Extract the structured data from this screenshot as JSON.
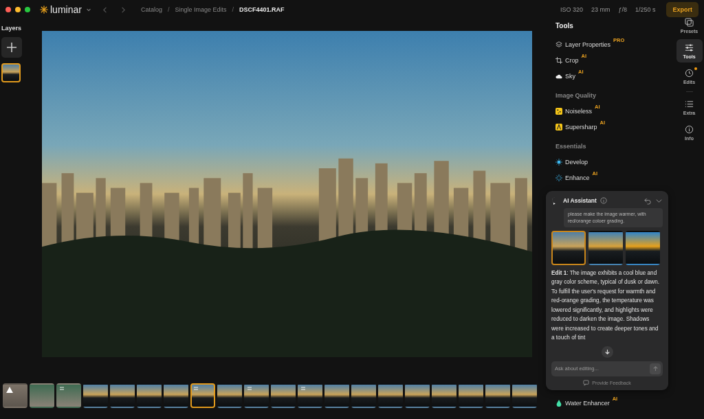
{
  "window": {
    "app_name": "luminar"
  },
  "breadcrumb": [
    {
      "label": "Catalog",
      "current": false
    },
    {
      "separator": "/",
      "label": "Single Image Edits",
      "current": false
    },
    {
      "separator": "/",
      "label": "DSCF4401.RAF",
      "current": true
    }
  ],
  "exif": [
    "ISO 320",
    "23 mm",
    "ƒ/8",
    "1/250 s"
  ],
  "export_button": "Export",
  "layers": {
    "title": "Layers",
    "items": [
      {
        "selected": true
      }
    ]
  },
  "tools": {
    "title": "Tools",
    "sections": [
      {
        "items": [
          {
            "label": "Layer Properties",
            "badge": "PRO"
          },
          {
            "label": "Crop",
            "badge": "AI"
          },
          {
            "label": "Sky",
            "badge": "AI"
          }
        ]
      },
      {
        "heading": "Image Quality",
        "items": [
          {
            "label": "Noiseless",
            "badge": "AI"
          },
          {
            "label": "Supersharp",
            "badge": "AI"
          }
        ]
      },
      {
        "heading": "Essentials",
        "items": [
          {
            "label": "Develop"
          },
          {
            "label": "Enhance",
            "badge": "AI"
          }
        ]
      }
    ],
    "bottom_item": {
      "label": "Water Enhancer",
      "badge": "AI"
    }
  },
  "rail": [
    {
      "label": "Presets",
      "selected": false,
      "notification": false
    },
    {
      "label": "Tools",
      "selected": true,
      "notification": false
    },
    {
      "label": "Edits",
      "selected": false,
      "notification": true
    },
    {
      "label": "Extra",
      "selected": false,
      "notification": false
    },
    {
      "label": "Info",
      "selected": false,
      "notification": false
    }
  ],
  "assistant": {
    "title": "AI Assistant",
    "prompt": "please make the image warmer, with red/orange coloer grading.",
    "variants": [
      {
        "selected": true
      },
      {
        "selected": false
      },
      {
        "selected": false
      }
    ],
    "response": "**Edit 1**: The image exhibits a cool blue and gray color scheme, typical of dusk or dawn. To fulfill the user's request for warmth and red-orange grading, the temperature was lowered significantly, and highlights were reduced to darken the image. Shadows were increased to create deeper tones and a touch of tint",
    "input_placeholder": "Ask about editing...",
    "feedback": "Provide Feedback"
  },
  "filmstrip": [
    {
      "kind": "object",
      "warning": true,
      "edited": false,
      "selected": false
    },
    {
      "kind": "portrait",
      "warning": false,
      "edited": false,
      "selected": false
    },
    {
      "kind": "portrait",
      "warning": false,
      "edited": true,
      "selected": false
    },
    {
      "kind": "city",
      "warning": false,
      "edited": false,
      "selected": false
    },
    {
      "kind": "city",
      "warning": false,
      "edited": false,
      "selected": false
    },
    {
      "kind": "city",
      "warning": false,
      "edited": false,
      "selected": false
    },
    {
      "kind": "city",
      "warning": false,
      "edited": false,
      "selected": false
    },
    {
      "kind": "city",
      "warning": false,
      "edited": true,
      "selected": true
    },
    {
      "kind": "city",
      "warning": false,
      "edited": false,
      "selected": false
    },
    {
      "kind": "city",
      "warning": false,
      "edited": true,
      "selected": false
    },
    {
      "kind": "city",
      "warning": false,
      "edited": false,
      "selected": false
    },
    {
      "kind": "city",
      "warning": false,
      "edited": true,
      "selected": false
    },
    {
      "kind": "city",
      "warning": false,
      "edited": false,
      "selected": false
    },
    {
      "kind": "city",
      "warning": false,
      "edited": false,
      "selected": false
    },
    {
      "kind": "city",
      "warning": false,
      "edited": false,
      "selected": false
    },
    {
      "kind": "city",
      "warning": false,
      "edited": false,
      "selected": false
    },
    {
      "kind": "city",
      "warning": false,
      "edited": false,
      "selected": false
    },
    {
      "kind": "city",
      "warning": false,
      "edited": false,
      "selected": false
    },
    {
      "kind": "city",
      "warning": false,
      "edited": false,
      "selected": false
    },
    {
      "kind": "city",
      "warning": false,
      "edited": false,
      "selected": false
    }
  ]
}
